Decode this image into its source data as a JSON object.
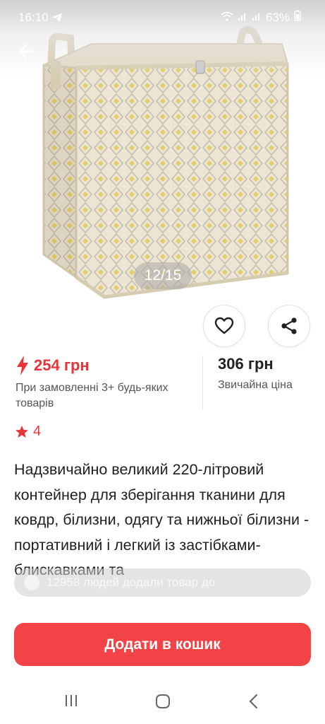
{
  "status_bar": {
    "time": "16:10",
    "battery": "63%",
    "icons": [
      "telegram-icon",
      "wifi-icon",
      "signal-icon",
      "signal-icon",
      "battery-icon"
    ]
  },
  "gallery": {
    "counter": "12/15"
  },
  "price": {
    "promo_price": "254 грн",
    "promo_condition": "При замовленні 3+ будь-яких товарів",
    "regular_price": "306 грн",
    "regular_label": "Звичайна ціна"
  },
  "rating": {
    "value": "4"
  },
  "product": {
    "title": "Надзвичайно великий 220-літровий контейнер для зберігання тканини для ковдр, білизни, одягу та нижньої білизни - портативний і легкий із застібками-блискавками та"
  },
  "toast": {
    "text": "12958 людей додали товар до"
  },
  "actions": {
    "add_to_cart": "Додати в кошик"
  },
  "colors": {
    "accent": "#f24347",
    "price_red": "#e8343a"
  }
}
